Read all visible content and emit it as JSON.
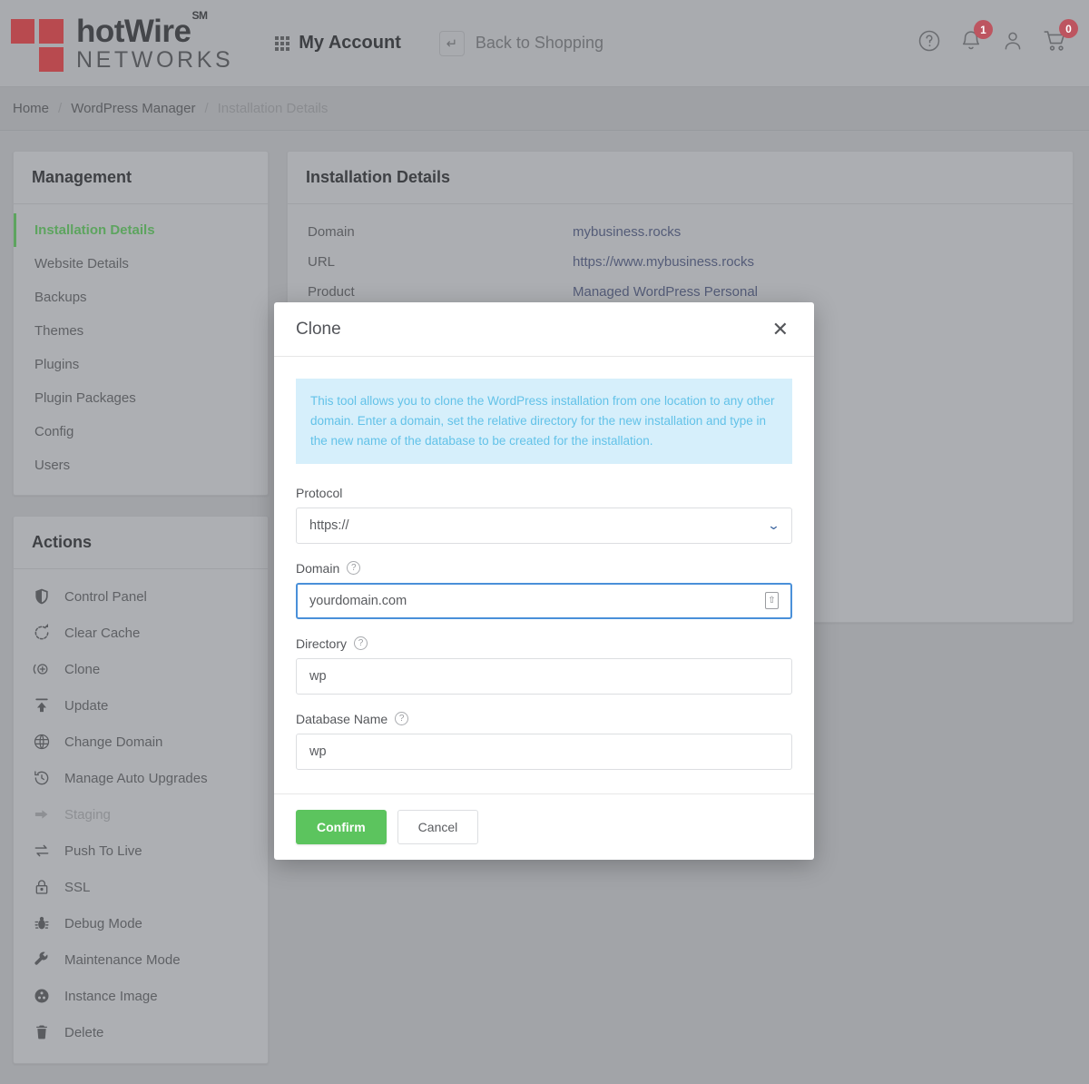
{
  "header": {
    "logo": {
      "brand_top": "hotWire",
      "sm": "SM",
      "brand_bottom": "NETWORKS",
      "color": "#b84a4f"
    },
    "my_account": "My Account",
    "back_to_shopping": "Back to Shopping",
    "help_icon": "question-circle-icon",
    "bell_icon": "bell-icon",
    "bell_badge": "1",
    "user_icon": "user-icon",
    "cart_icon": "cart-icon",
    "cart_badge": "0",
    "badge_color": "#bd5560"
  },
  "breadcrumb": {
    "home": "Home",
    "sep1": "/",
    "section": "WordPress Manager",
    "sep2": "/",
    "current": "Installation Details"
  },
  "sidebar": {
    "management": {
      "title": "Management",
      "items": [
        {
          "label": "Installation Details",
          "active": true
        },
        {
          "label": "Website Details",
          "active": false
        },
        {
          "label": "Backups",
          "active": false
        },
        {
          "label": "Themes",
          "active": false
        },
        {
          "label": "Plugins",
          "active": false
        },
        {
          "label": "Plugin Packages",
          "active": false
        },
        {
          "label": "Config",
          "active": false
        },
        {
          "label": "Users",
          "active": false
        }
      ],
      "active_color": "#5da45f"
    },
    "actions": {
      "title": "Actions",
      "items": [
        {
          "label": "Control Panel",
          "icon": "shield-icon",
          "disabled": false
        },
        {
          "label": "Clear Cache",
          "icon": "refresh-icon",
          "disabled": false
        },
        {
          "label": "Clone",
          "icon": "clone-plus-icon",
          "disabled": false
        },
        {
          "label": "Update",
          "icon": "upload-icon",
          "disabled": false
        },
        {
          "label": "Change Domain",
          "icon": "globe-icon",
          "disabled": false
        },
        {
          "label": "Manage Auto Upgrades",
          "icon": "history-clock-icon",
          "disabled": false
        },
        {
          "label": "Staging",
          "icon": "arrow-right-icon",
          "disabled": true
        },
        {
          "label": "Push To Live",
          "icon": "swap-arrows-icon",
          "disabled": false
        },
        {
          "label": "SSL",
          "icon": "lock-icon",
          "disabled": false
        },
        {
          "label": "Debug Mode",
          "icon": "bug-icon",
          "disabled": false
        },
        {
          "label": "Maintenance Mode",
          "icon": "wrench-icon",
          "disabled": false
        },
        {
          "label": "Instance Image",
          "icon": "film-reel-icon",
          "disabled": false
        },
        {
          "label": "Delete",
          "icon": "trash-icon",
          "disabled": false
        }
      ]
    }
  },
  "main": {
    "title": "Installation Details",
    "rows": [
      {
        "key": "Domain",
        "value": "mybusiness.rocks"
      },
      {
        "key": "URL",
        "value": "https://www.mybusiness.rocks"
      },
      {
        "key": "Product",
        "value": "Managed WordPress Personal"
      }
    ],
    "link_color": "#545c78"
  },
  "modal": {
    "title": "Clone",
    "close_icon": "close-icon",
    "info": "This tool allows you to clone the WordPress installation from one location to any other domain. Enter a domain, set the relative directory for the new installation and type in the new name of the database to be created for the installation.",
    "info_bg": "#d6effb",
    "info_color": "#63c2e8",
    "fields": [
      {
        "label": "Protocol",
        "value": "https://",
        "type": "select",
        "help": false,
        "focused": false,
        "icon": "chevron-down-icon"
      },
      {
        "label": "Domain",
        "value": "yourdomain.com",
        "type": "text",
        "help": true,
        "focused": true,
        "icon": "save-credential-icon"
      },
      {
        "label": "Directory",
        "value": "wp",
        "type": "text",
        "help": true,
        "focused": false,
        "icon": ""
      },
      {
        "label": "Database Name",
        "value": "wp",
        "type": "text",
        "help": true,
        "focused": false,
        "icon": ""
      }
    ],
    "help_icon": "question-circle-icon",
    "confirm_label": "Confirm",
    "cancel_label": "Cancel",
    "confirm_color": "#5cc45e",
    "focus_color": "#4a90d9"
  }
}
